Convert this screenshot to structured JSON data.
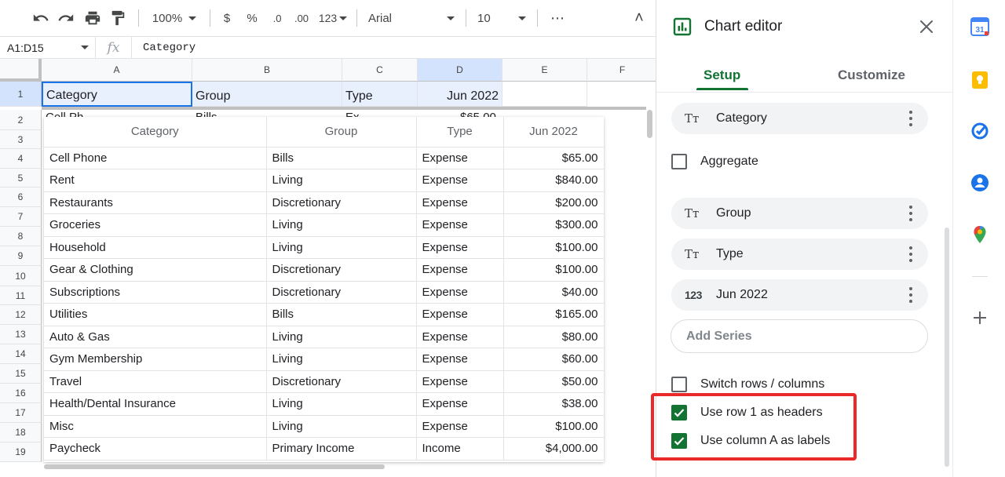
{
  "toolbar": {
    "zoom": "100%",
    "currency": "$",
    "percent": "%",
    "decrease_decimal": ".0",
    "increase_decimal": ".00",
    "more_formats": "123",
    "font": "Arial",
    "font_size": "10",
    "more": "⋯",
    "collapse": "˄"
  },
  "formula_bar": {
    "range": "A1:D15",
    "fx": "fx",
    "value": "Category"
  },
  "grid": {
    "columns": [
      "A",
      "B",
      "C",
      "D",
      "E",
      "F"
    ],
    "rows": [
      "1",
      "2",
      "3",
      "4",
      "5",
      "6",
      "7",
      "8",
      "9",
      "10",
      "11",
      "12",
      "13",
      "14",
      "15",
      "16",
      "17",
      "18",
      "19"
    ],
    "header_row": [
      "Category",
      "Group",
      "Type",
      "Jun 2022"
    ],
    "row2_peek": [
      "Cell Ph",
      "Bills",
      "Ex",
      "$65.00"
    ]
  },
  "preview": {
    "headers": [
      "Category",
      "Group",
      "Type",
      "Jun 2022"
    ],
    "rows": [
      [
        "Cell Phone",
        "Bills",
        "Expense",
        "$65.00"
      ],
      [
        "Rent",
        "Living",
        "Expense",
        "$840.00"
      ],
      [
        "Restaurants",
        "Discretionary",
        "Expense",
        "$200.00"
      ],
      [
        "Groceries",
        "Living",
        "Expense",
        "$300.00"
      ],
      [
        "Household",
        "Living",
        "Expense",
        "$100.00"
      ],
      [
        "Gear & Clothing",
        "Discretionary",
        "Expense",
        "$100.00"
      ],
      [
        "Subscriptions",
        "Discretionary",
        "Expense",
        "$40.00"
      ],
      [
        "Utilities",
        "Bills",
        "Expense",
        "$165.00"
      ],
      [
        "Auto & Gas",
        "Living",
        "Expense",
        "$80.00"
      ],
      [
        "Gym Membership",
        "Living",
        "Expense",
        "$60.00"
      ],
      [
        "Travel",
        "Discretionary",
        "Expense",
        "$50.00"
      ],
      [
        "Health/Dental Insurance",
        "Living",
        "Expense",
        "$38.00"
      ],
      [
        "Misc",
        "Living",
        "Expense",
        "$100.00"
      ],
      [
        "Paycheck",
        "Primary Income",
        "Income",
        "$4,000.00"
      ]
    ]
  },
  "editor": {
    "title": "Chart editor",
    "tabs": {
      "setup": "Setup",
      "customize": "Customize"
    },
    "chip_category": "Category",
    "aggregate": "Aggregate",
    "series": [
      "Group",
      "Type",
      "Jun 2022"
    ],
    "type_text_icon": "Tт",
    "type_num_icon": "123",
    "add_series": "Add Series",
    "switch_rows": "Switch rows / columns",
    "use_row1": "Use row 1 as headers",
    "use_colA": "Use column A as labels",
    "checks": {
      "aggregate": false,
      "switch_rows": false,
      "use_row1": true,
      "use_colA": true
    }
  },
  "colors": {
    "accent_green": "#137333",
    "highlight_red": "#ea2a2a",
    "selection_blue": "#1a73e8"
  },
  "icons": [
    "undo-icon",
    "redo-icon",
    "print-icon",
    "paint-format-icon",
    "chart-icon",
    "close-icon",
    "calendar-icon",
    "keep-icon",
    "tasks-icon",
    "contacts-icon",
    "maps-icon",
    "add-icon"
  ]
}
